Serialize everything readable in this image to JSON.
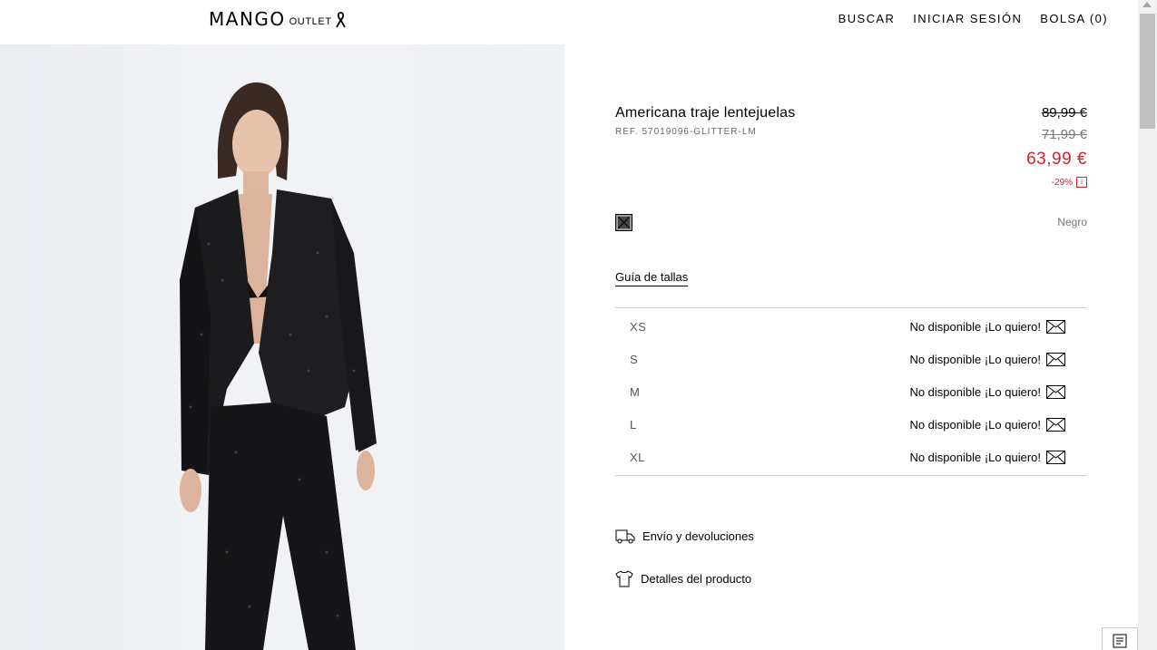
{
  "header": {
    "logo_main": "MANGO",
    "logo_sub": "OUTLET",
    "nav": {
      "search": "BUSCAR",
      "login": "INICIAR SESIÓN",
      "bag": "BOLSA (0)"
    }
  },
  "product": {
    "title": "Americana traje lentejuelas",
    "ref": "REF. 57019096-GLITTER-LM",
    "prices": {
      "original": "89,99 €",
      "previous": "71,99 €",
      "current": "63,99 €",
      "discount": "-29%"
    },
    "color": {
      "name": "Negro",
      "swatch_hex": "#444444"
    },
    "size_guide_label": "Guía de tallas",
    "sizes": [
      {
        "label": "XS",
        "status": "No disponible ¡Lo quiero!"
      },
      {
        "label": "S",
        "status": "No disponible ¡Lo quiero!"
      },
      {
        "label": "M",
        "status": "No disponible ¡Lo quiero!"
      },
      {
        "label": "L",
        "status": "No disponible ¡Lo quiero!"
      },
      {
        "label": "XL",
        "status": "No disponible ¡Lo quiero!"
      }
    ],
    "links": {
      "shipping": "Envío y devoluciones",
      "details": "Detalles del producto"
    }
  },
  "colors": {
    "sale_red": "#d2232a",
    "text": "#000000",
    "muted": "#777777"
  },
  "icons": [
    "ribbon-icon",
    "info-icon",
    "mail-icon",
    "truck-icon",
    "shirt-icon",
    "chat-icon"
  ]
}
